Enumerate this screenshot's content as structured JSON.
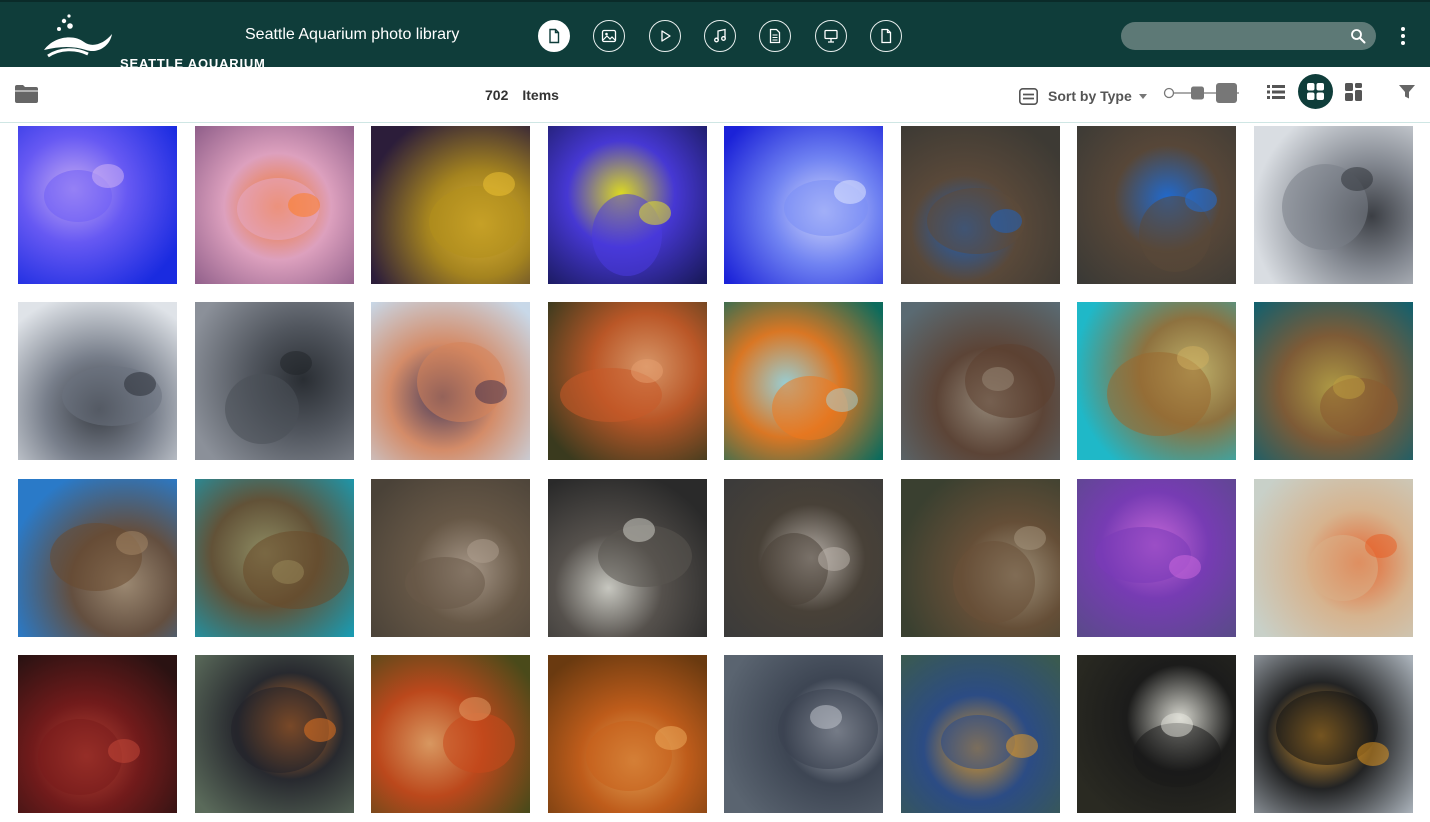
{
  "header": {
    "logo_text": "SEATTLE AQUARIUM",
    "title": "Seattle Aquarium photo library",
    "type_filters": [
      {
        "icon": "document-icon",
        "active": true
      },
      {
        "icon": "image-icon",
        "active": false
      },
      {
        "icon": "play-icon",
        "active": false
      },
      {
        "icon": "music-icon",
        "active": false
      },
      {
        "icon": "text-document-icon",
        "active": false
      },
      {
        "icon": "presentation-icon",
        "active": false
      },
      {
        "icon": "file-icon",
        "active": false
      }
    ],
    "search": {
      "placeholder": "",
      "value": ""
    }
  },
  "toolbar": {
    "count": "702",
    "count_label": "Items",
    "sort_label": "Sort by Type",
    "views": [
      "list",
      "grid",
      "mosaic"
    ],
    "active_view": "grid"
  },
  "colors": {
    "brand": "#0f3d3a",
    "search_bg": "#5d7976",
    "toolbar_border": "#cfe6e4"
  },
  "photos": [
    {
      "subject": "jellyfish",
      "bg": "#1a2be0",
      "mid": "#6f5ef5",
      "hi": "#d6b8f5"
    },
    {
      "subject": "clownfish in anemone",
      "bg": "#8a5a86",
      "mid": "#e6a8c4",
      "hi": "#ff7a1a"
    },
    {
      "subject": "yellow coral",
      "bg": "#2c1d3a",
      "mid": "#b28f1c",
      "hi": "#f2c534"
    },
    {
      "subject": "yellow tang",
      "bg": "#1a1a5e",
      "mid": "#4b3be0",
      "hi": "#f2ef1a"
    },
    {
      "subject": "moon jellyfish",
      "bg": "#1b22d8",
      "mid": "#7a8ef5",
      "hi": "#e6ecff"
    },
    {
      "subject": "river otter",
      "bg": "#3d3a34",
      "mid": "#5c4a3a",
      "hi": "#1a64c8"
    },
    {
      "subject": "otters on blue mat",
      "bg": "#3b3a36",
      "mid": "#5a4838",
      "hi": "#1d6fe0"
    },
    {
      "subject": "harbor seal",
      "bg": "#d9dde2",
      "mid": "#7a7f88",
      "hi": "#2a2d33"
    },
    {
      "subject": "harbor seal",
      "bg": "#dfe3e8",
      "mid": "#6c7380",
      "hi": "#262a31"
    },
    {
      "subject": "harbor seal",
      "bg": "#8b9099",
      "mid": "#4b5058",
      "hi": "#1f2328"
    },
    {
      "subject": "visitors at exhibit",
      "bg": "#c8d8e8",
      "mid": "#d5835a",
      "hi": "#3a2a4a"
    },
    {
      "subject": "giant pacific octopus",
      "bg": "#3a3a1e",
      "mid": "#c85a28",
      "hi": "#e8a070"
    },
    {
      "subject": "rockfish",
      "bg": "#0d6b5c",
      "mid": "#f0781e",
      "hi": "#a8d8e0"
    },
    {
      "subject": "river otter",
      "bg": "#5a6a72",
      "mid": "#5c4030",
      "hi": "#9a8a78"
    },
    {
      "subject": "sea otter swimming",
      "bg": "#1fb8c8",
      "mid": "#9a6a30",
      "hi": "#d0b060"
    },
    {
      "subject": "sea otter swimming",
      "bg": "#0d6070",
      "mid": "#8a5a30",
      "hi": "#c0a040"
    },
    {
      "subject": "otters sleeping",
      "bg": "#2a7ac8",
      "mid": "#6a4a30",
      "hi": "#a88a68"
    },
    {
      "subject": "otter underwater",
      "bg": "#1a9ab0",
      "mid": "#6a4a2a",
      "hi": "#9a8a5a"
    },
    {
      "subject": "otter close-up",
      "bg": "#4a4238",
      "mid": "#6a5a48",
      "hi": "#b0a090"
    },
    {
      "subject": "otters",
      "bg": "#2a2a2a",
      "mid": "#5a5550",
      "hi": "#d8d8d0"
    },
    {
      "subject": "otters on rocks",
      "bg": "#3a3a3a",
      "mid": "#4a4238",
      "hi": "#c0b8b0"
    },
    {
      "subject": "otter resting",
      "bg": "#3a4030",
      "mid": "#6a5038",
      "hi": "#a89880"
    },
    {
      "subject": "purple tang",
      "bg": "#5a4a8a",
      "mid": "#7a3ab8",
      "hi": "#d06ae0"
    },
    {
      "subject": "octopus on glass",
      "bg": "#c8d0c8",
      "mid": "#d8b088",
      "hi": "#e85a20"
    },
    {
      "subject": "red octopus",
      "bg": "#2a1212",
      "mid": "#7a1c1c",
      "hi": "#c84a3a"
    },
    {
      "subject": "black oystercatcher",
      "bg": "#5a6a5a",
      "mid": "#22222a",
      "hi": "#f07820"
    },
    {
      "subject": "octopus",
      "bg": "#4a4a1a",
      "mid": "#c8481c",
      "hi": "#e8a068"
    },
    {
      "subject": "octopus",
      "bg": "#6a3a10",
      "mid": "#c8601c",
      "hi": "#f0b060"
    },
    {
      "subject": "harbor seal",
      "bg": "#5a6470",
      "mid": "#3a4250",
      "hi": "#c8ccd4"
    },
    {
      "subject": "tufted puffin",
      "bg": "#3a5a50",
      "mid": "#2a4a8a",
      "hi": "#f0a020"
    },
    {
      "subject": "tufted puffin with grass",
      "bg": "#2a2a22",
      "mid": "#1a1a1a",
      "hi": "#e8e8e0"
    },
    {
      "subject": "tufted puffin",
      "bg": "#a8b0b8",
      "mid": "#141414",
      "hi": "#f0a020"
    }
  ]
}
